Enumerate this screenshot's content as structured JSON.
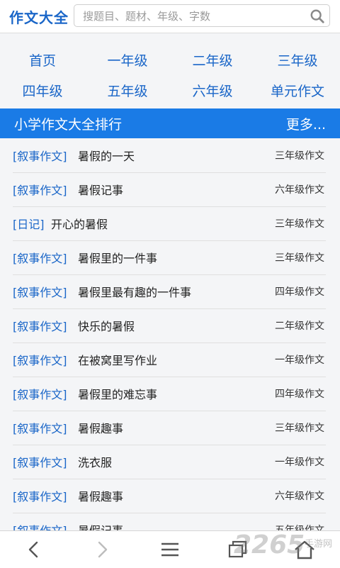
{
  "header": {
    "logo": "作文大全",
    "search_placeholder": "搜题目、题材、年级、字数"
  },
  "nav": {
    "items": [
      "首页",
      "一年级",
      "二年级",
      "三年级",
      "四年级",
      "五年级",
      "六年级",
      "单元作文"
    ]
  },
  "section": {
    "title": "小学作文大全排行",
    "more": "更多..."
  },
  "list": {
    "items": [
      {
        "category": "[叙事作文]",
        "title": "暑假的一天",
        "grade": "三年级作文"
      },
      {
        "category": "[叙事作文]",
        "title": "暑假记事",
        "grade": "六年级作文"
      },
      {
        "category": "[日记]",
        "title": "开心的暑假",
        "grade": "三年级作文"
      },
      {
        "category": "[叙事作文]",
        "title": "暑假里的一件事",
        "grade": "三年级作文"
      },
      {
        "category": "[叙事作文]",
        "title": "暑假里最有趣的一件事",
        "grade": "四年级作文"
      },
      {
        "category": "[叙事作文]",
        "title": "快乐的暑假",
        "grade": "二年级作文"
      },
      {
        "category": "[叙事作文]",
        "title": "在被窝里写作业",
        "grade": "一年级作文"
      },
      {
        "category": "[叙事作文]",
        "title": "暑假里的难忘事",
        "grade": "四年级作文"
      },
      {
        "category": "[叙事作文]",
        "title": "暑假趣事",
        "grade": "三年级作文"
      },
      {
        "category": "[叙事作文]",
        "title": "洗衣服",
        "grade": "一年级作文"
      },
      {
        "category": "[叙事作文]",
        "title": "暑假趣事",
        "grade": "六年级作文"
      },
      {
        "category": "[叙事作文]",
        "title": "暑假记事",
        "grade": "五年级作文"
      }
    ]
  },
  "watermark": {
    "number": "2265",
    "site": "手游网"
  },
  "colors": {
    "accent": "#1a66c8",
    "bar": "#1a7be6",
    "background": "#f4f5f7"
  }
}
